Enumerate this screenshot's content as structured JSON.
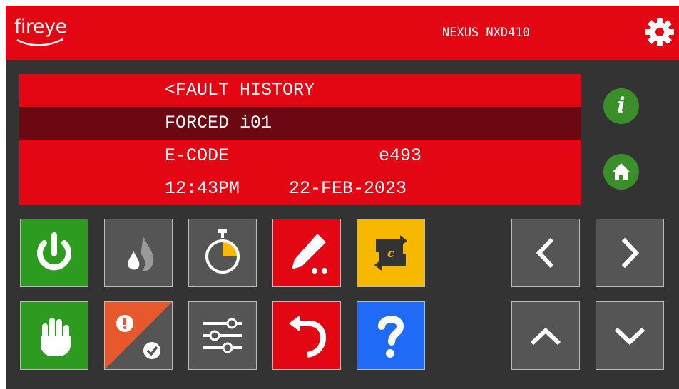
{
  "header": {
    "brand": "fireye",
    "model": "NEXUS NXD410"
  },
  "display": {
    "title": "<FAULT HISTORY",
    "selected": "FORCED i01",
    "code_label": "E-CODE",
    "code_value": "e493",
    "time": "12:43PM",
    "date": "22-FEB-2023"
  },
  "side_buttons": {
    "info_glyph": "i"
  },
  "icons": {
    "gear": "gear-icon",
    "info": "info-icon",
    "home": "home-icon",
    "power": "power-icon",
    "flame": "flame-icon",
    "timer": "timer-icon",
    "edit": "pencil-icon",
    "cycle": "cycle-c-icon",
    "hand": "hand-stop-icon",
    "alarm_ack": "alarm-acknowledge-icon",
    "sliders": "sliders-icon",
    "undo": "undo-icon",
    "help": "help-icon",
    "left": "chevron-left-icon",
    "right": "chevron-right-icon",
    "up": "chevron-up-icon",
    "down": "chevron-down-icon"
  },
  "colors": {
    "brand_red": "#e30613",
    "selected_row": "#6b0812",
    "green": "#2c9b1f",
    "gray": "#555555",
    "yellow": "#f7b800",
    "blue": "#1f6bf5",
    "orange": "#e8582d",
    "background": "#333333"
  }
}
